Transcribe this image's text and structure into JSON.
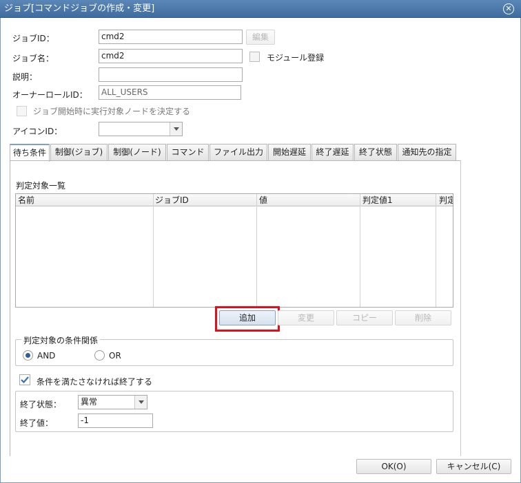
{
  "window": {
    "title": "ジョブ[コマンドジョブの作成・変更]"
  },
  "form": {
    "job_id_label": "ジョブID：",
    "job_id_value": "cmd2",
    "edit_button": "編集",
    "job_name_label": "ジョブ名：",
    "job_name_value": "cmd2",
    "module_register_label": "モジュール登録",
    "description_label": "説明：",
    "description_value": "",
    "owner_role_label": "オーナーロールID：",
    "owner_role_value": "ALL_USERS",
    "decide_node_label": "ジョブ開始時に実行対象ノードを決定する",
    "icon_id_label": "アイコンID：",
    "icon_id_value": ""
  },
  "tabs": [
    {
      "label": "待ち条件"
    },
    {
      "label": "制御(ジョブ)"
    },
    {
      "label": "制御(ノード)"
    },
    {
      "label": "コマンド"
    },
    {
      "label": "ファイル出力"
    },
    {
      "label": "開始遅延"
    },
    {
      "label": "終了遅延"
    },
    {
      "label": "終了状態"
    },
    {
      "label": "通知先の指定"
    }
  ],
  "wait_conditions": {
    "list_label": "判定対象一覧",
    "columns": [
      "名前",
      "ジョブID",
      "値",
      "判定値1",
      "判定"
    ],
    "rows": [],
    "add_button": "追加",
    "modify_button": "変更",
    "copy_button": "コピー",
    "delete_button": "削除",
    "relation_legend": "判定対象の条件関係",
    "and_label": "AND",
    "or_label": "OR",
    "and_selected": true,
    "end_if_unmet_label": "条件を満たさなければ終了する",
    "end_if_unmet_checked": true,
    "end_status_label": "終了状態：",
    "end_status_value": "異常",
    "end_value_label": "終了値：",
    "end_value_value": "-1"
  },
  "footer": {
    "ok_button": "OK(O)",
    "cancel_button": "キャンセル(C)"
  },
  "colors": {
    "title_bar": "#4a77aa",
    "highlight": "#e0101a",
    "radio_selected": "#2d5fa0"
  }
}
